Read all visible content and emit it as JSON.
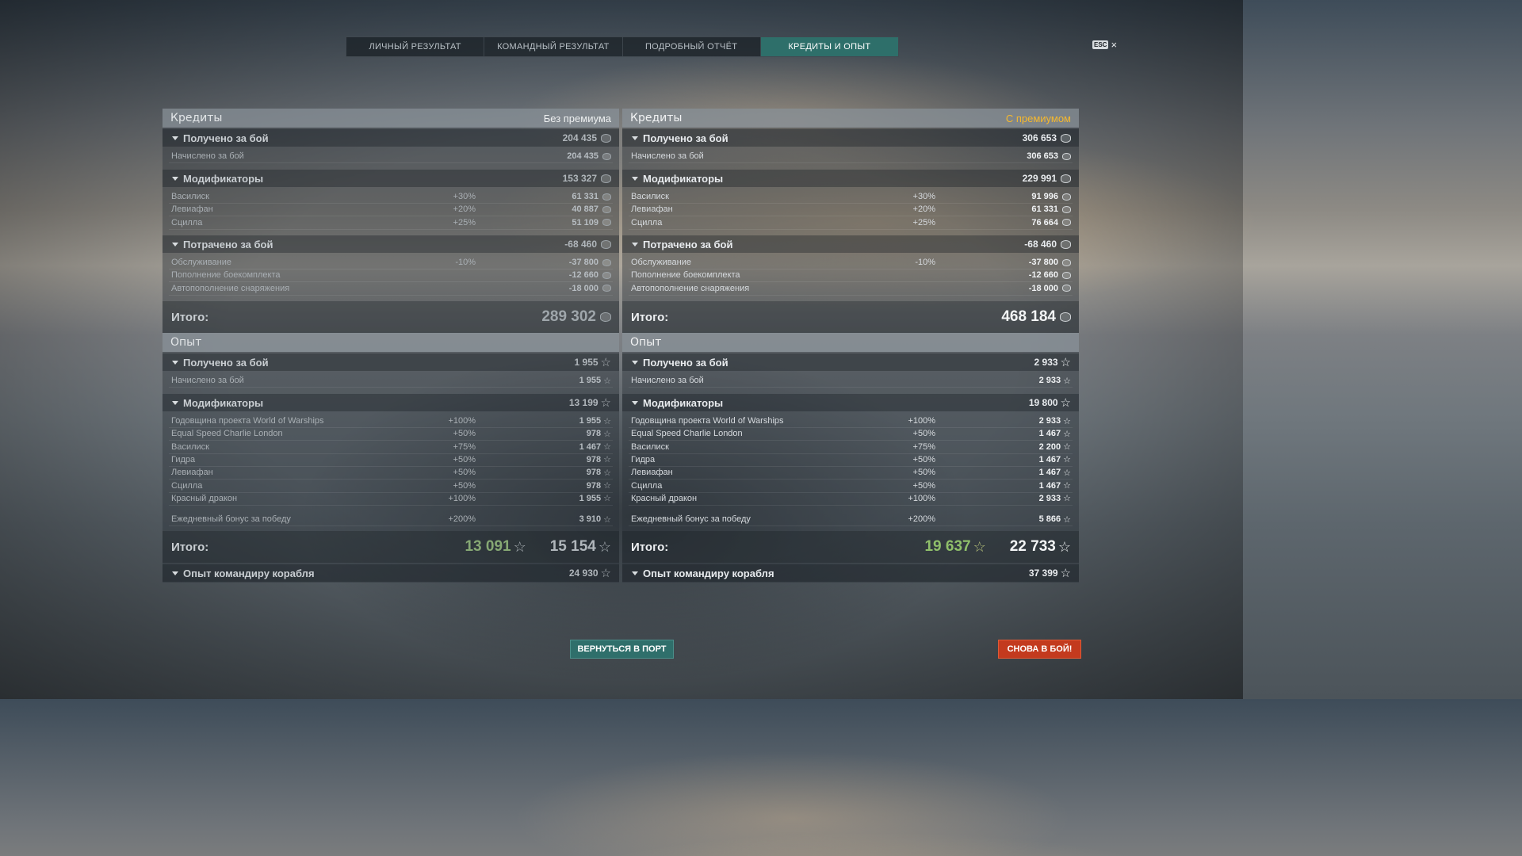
{
  "tabs": [
    "ЛИЧНЫЙ РЕЗУЛЬТАТ",
    "КОМАНДНЫЙ РЕЗУЛЬТАТ",
    "ПОДРОБНЫЙ ОТЧЁТ",
    "КРЕДИТЫ И ОПЫТ"
  ],
  "active_tab": "КРЕДИТЫ И ОПЫТ",
  "esc_label": "ESC",
  "close_glyph": "×",
  "left": {
    "credits": {
      "title": "Кредиты",
      "tag": "Без премиума",
      "earned": {
        "label": "Получено за бой",
        "value": "204 435",
        "items": [
          {
            "label": "Начислено за бой",
            "value": "204 435"
          }
        ]
      },
      "modifiers": {
        "label": "Модификаторы",
        "value": "153 327",
        "items": [
          {
            "label": "Василиск",
            "pct": "+30%",
            "value": "61 331"
          },
          {
            "label": "Левиафан",
            "pct": "+20%",
            "value": "40 887"
          },
          {
            "label": "Сцилла",
            "pct": "+25%",
            "value": "51 109"
          }
        ]
      },
      "spent": {
        "label": "Потрачено за бой",
        "value": "-68 460",
        "items": [
          {
            "label": "Обслуживание",
            "pct": "-10%",
            "value": "-37 800"
          },
          {
            "label": "Пополнение боекомплекта",
            "pct": "",
            "value": "-12 660"
          },
          {
            "label": "Автопополнение снаряжения",
            "pct": "",
            "value": "-18 000"
          }
        ]
      },
      "total_label": "Итого:",
      "total_value": "289 302"
    },
    "xp": {
      "title": "Опыт",
      "earned": {
        "label": "Получено за бой",
        "value": "1 955",
        "items": [
          {
            "label": "Начислено за бой",
            "value": "1 955"
          }
        ]
      },
      "modifiers": {
        "label": "Модификаторы",
        "value": "13 199",
        "items": [
          {
            "label": "Годовщина проекта World of Warships",
            "pct": "+100%",
            "value": "1 955"
          },
          {
            "label": "Equal Speed Charlie London",
            "pct": "+50%",
            "value": "978"
          },
          {
            "label": "Василиск",
            "pct": "+75%",
            "value": "1 467"
          },
          {
            "label": "Гидра",
            "pct": "+50%",
            "value": "978"
          },
          {
            "label": "Левиафан",
            "pct": "+50%",
            "value": "978"
          },
          {
            "label": "Сцилла",
            "pct": "+50%",
            "value": "978"
          },
          {
            "label": "Красный дракон",
            "pct": "+100%",
            "value": "1 955"
          }
        ]
      },
      "daily": {
        "label": "Ежедневный бонус за победу",
        "pct": "+200%",
        "value": "3 910"
      },
      "total_label": "Итого:",
      "total_green": "13 091",
      "total_value": "15 154",
      "commander": {
        "label": "Опыт командиру корабля",
        "value": "24 930"
      }
    }
  },
  "right": {
    "credits": {
      "title": "Кредиты",
      "tag": "С премиумом",
      "earned": {
        "label": "Получено за бой",
        "value": "306 653",
        "items": [
          {
            "label": "Начислено за бой",
            "value": "306 653"
          }
        ]
      },
      "modifiers": {
        "label": "Модификаторы",
        "value": "229 991",
        "items": [
          {
            "label": "Василиск",
            "pct": "+30%",
            "value": "91 996"
          },
          {
            "label": "Левиафан",
            "pct": "+20%",
            "value": "61 331"
          },
          {
            "label": "Сцилла",
            "pct": "+25%",
            "value": "76 664"
          }
        ]
      },
      "spent": {
        "label": "Потрачено за бой",
        "value": "-68 460",
        "items": [
          {
            "label": "Обслуживание",
            "pct": "-10%",
            "value": "-37 800"
          },
          {
            "label": "Пополнение боекомплекта",
            "pct": "",
            "value": "-12 660"
          },
          {
            "label": "Автопополнение снаряжения",
            "pct": "",
            "value": "-18 000"
          }
        ]
      },
      "total_label": "Итого:",
      "total_value": "468 184"
    },
    "xp": {
      "title": "Опыт",
      "earned": {
        "label": "Получено за бой",
        "value": "2 933",
        "items": [
          {
            "label": "Начислено за бой",
            "value": "2 933"
          }
        ]
      },
      "modifiers": {
        "label": "Модификаторы",
        "value": "19 800",
        "items": [
          {
            "label": "Годовщина проекта World of Warships",
            "pct": "+100%",
            "value": "2 933"
          },
          {
            "label": "Equal Speed Charlie London",
            "pct": "+50%",
            "value": "1 467"
          },
          {
            "label": "Василиск",
            "pct": "+75%",
            "value": "2 200"
          },
          {
            "label": "Гидра",
            "pct": "+50%",
            "value": "1 467"
          },
          {
            "label": "Левиафан",
            "pct": "+50%",
            "value": "1 467"
          },
          {
            "label": "Сцилла",
            "pct": "+50%",
            "value": "1 467"
          },
          {
            "label": "Красный дракон",
            "pct": "+100%",
            "value": "2 933"
          }
        ]
      },
      "daily": {
        "label": "Ежедневный бонус за победу",
        "pct": "+200%",
        "value": "5 866"
      },
      "total_label": "Итого:",
      "total_green": "19 637",
      "total_value": "22 733",
      "commander": {
        "label": "Опыт командиру корабля",
        "value": "37 399"
      }
    }
  },
  "buttons": {
    "back": "ВЕРНУТЬСЯ В ПОРТ",
    "battle": "СНОВА В БОЙ!"
  },
  "colors": {
    "active_tab": "#2e6f6a",
    "premium_tag": "#f5b82e",
    "xp_green": "#8fbf6a",
    "battle_button": "#c33a1e",
    "back_button": "#2f6f6b"
  },
  "icons": {
    "credit": "credit-coin-icon",
    "xp": "xp-star-icon",
    "collapse": "caret-down-icon"
  }
}
